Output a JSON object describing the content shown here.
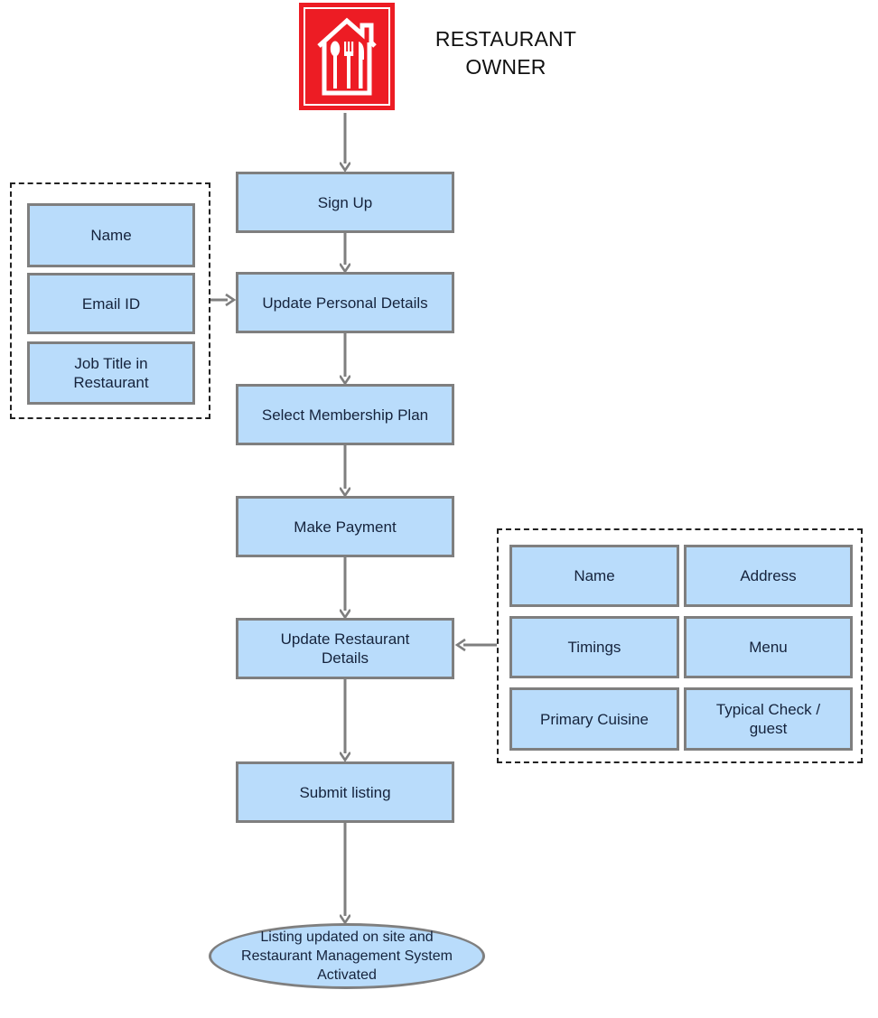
{
  "diagram": {
    "title": "Restaurant Owner Sign-Up and Listing Flow",
    "colors": {
      "node_fill": "#b9dcfb",
      "node_border": "#7f7f7f",
      "group_border": "#222222",
      "connector": "#7f7f7f",
      "logo_red": "#ed1c24",
      "text": "#15233c"
    }
  },
  "actor": {
    "icon": "restaurant-house-cutlery-icon",
    "label": "RESTAURANT\nOWNER",
    "label_line1": "RESTAURANT",
    "label_line2": "OWNER"
  },
  "flow": {
    "steps": [
      {
        "id": "sign-up",
        "label": "Sign Up"
      },
      {
        "id": "update-personal-details",
        "label": "Update Personal Details"
      },
      {
        "id": "select-membership-plan",
        "label": "Select Membership Plan"
      },
      {
        "id": "make-payment",
        "label": "Make Payment"
      },
      {
        "id": "update-restaurant-details",
        "label": "Update Restaurant\nDetails"
      },
      {
        "id": "submit-listing",
        "label": "Submit listing"
      }
    ],
    "terminal": {
      "id": "listing-activated",
      "label": "Listing updated on site and\nRestaurant Management System\nActivated"
    }
  },
  "personal_details_group": {
    "name": "personal-details-fields",
    "fields": [
      {
        "id": "name",
        "label": "Name"
      },
      {
        "id": "email-id",
        "label": "Email ID"
      },
      {
        "id": "job-title",
        "label": "Job Title in\nRestaurant"
      }
    ]
  },
  "restaurant_details_group": {
    "name": "restaurant-details-fields",
    "fields": [
      {
        "id": "name",
        "label": "Name"
      },
      {
        "id": "address",
        "label": "Address"
      },
      {
        "id": "timings",
        "label": "Timings"
      },
      {
        "id": "menu",
        "label": "Menu"
      },
      {
        "id": "primary-cuisine",
        "label": "Primary Cuisine"
      },
      {
        "id": "typical-check-guest",
        "label": "Typical Check /\nguest"
      }
    ]
  }
}
